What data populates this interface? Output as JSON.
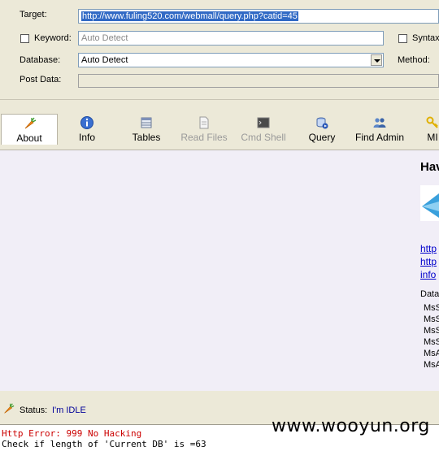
{
  "form": {
    "target_label": "Target:",
    "target_value": "http://www.fuling520.com/webmall/query.php?catid=45",
    "keyword_label": "Keyword:",
    "keyword_placeholder": "Auto Detect",
    "syntax_label": "Syntax",
    "database_label": "Database:",
    "database_value": "Auto Detect",
    "method_label": "Method:",
    "postdata_label": "Post Data:"
  },
  "toolbar": {
    "items": [
      {
        "label": "About",
        "icon": "carrot-icon",
        "state": "active"
      },
      {
        "label": "Info",
        "icon": "info-icon",
        "state": "normal"
      },
      {
        "label": "Tables",
        "icon": "table-icon",
        "state": "normal"
      },
      {
        "label": "Read Files",
        "icon": "file-icon",
        "state": "disabled"
      },
      {
        "label": "Cmd Shell",
        "icon": "terminal-icon",
        "state": "disabled"
      },
      {
        "label": "Query",
        "icon": "query-icon",
        "state": "normal"
      },
      {
        "label": "Find Admin",
        "icon": "users-icon",
        "state": "normal"
      },
      {
        "label": "MI",
        "icon": "key-icon",
        "state": "normal"
      }
    ]
  },
  "about_panel": {
    "heading": "Hav",
    "link1": "http",
    "link2": "http",
    "link3": "info",
    "db_heading": "Data",
    "db_items": [
      "MsS",
      "MsS",
      "MsS",
      "MsS",
      "MsA",
      "MsA"
    ]
  },
  "status": {
    "label": "Status:",
    "value": "I'm IDLE"
  },
  "log": {
    "line1": "Http Error: 999 No Hacking",
    "line2": "Check if length of 'Current DB' is =63"
  },
  "watermark": "www.wooyun.org",
  "colors": {
    "selection": "#316ac5",
    "error_text": "#cc0000",
    "status_value": "#000099",
    "link": "#0000cc",
    "content_bg": "#f1eef7",
    "window_bg": "#ece9d8"
  }
}
